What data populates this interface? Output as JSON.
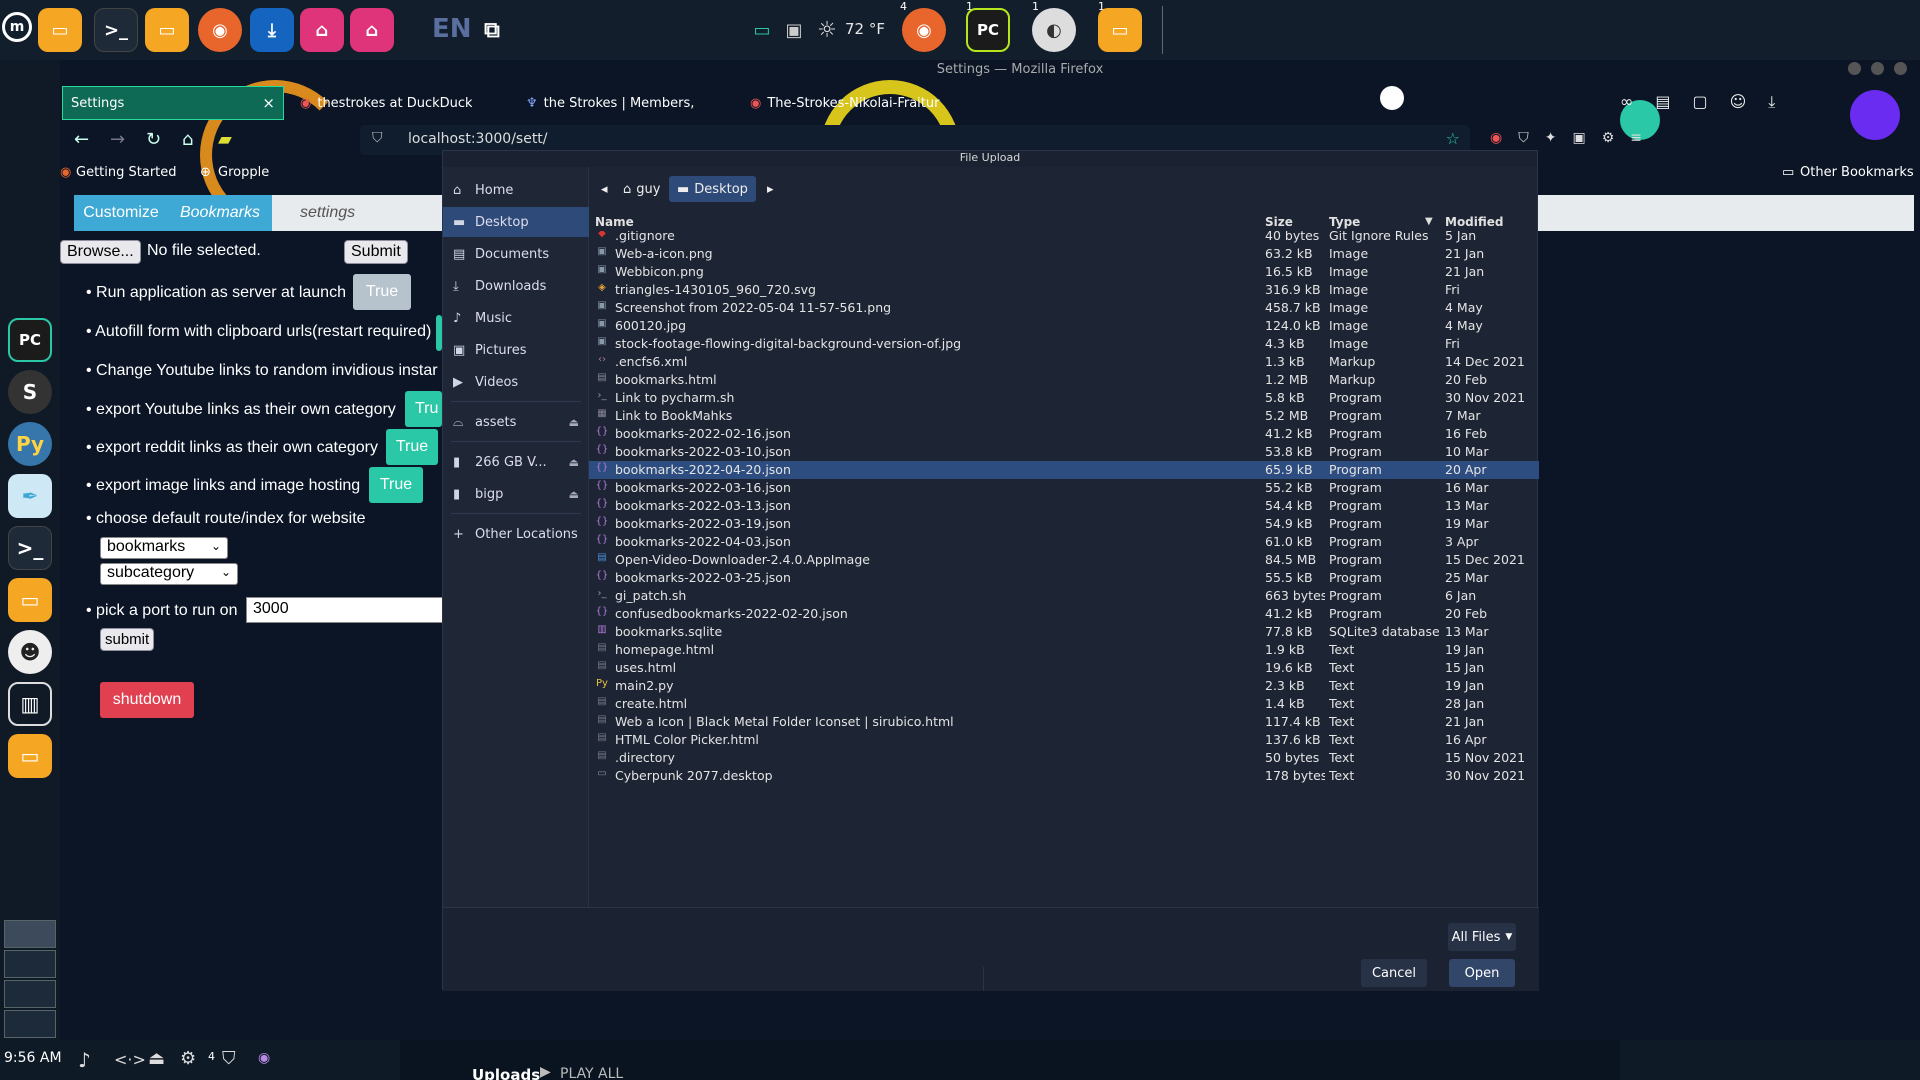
{
  "window_title": "Settings — Mozilla Firefox",
  "topbar": {
    "language": "EN",
    "weather": "72 °F",
    "badges": [
      "4",
      "1",
      "1",
      "1"
    ]
  },
  "tabs": [
    {
      "label": "Settings",
      "close": "×"
    },
    {
      "label": "thestrokes at DuckDuckGo",
      "close": "×"
    },
    {
      "label": "the Strokes | Members, Alb",
      "close": "×"
    },
    {
      "label": "The-Strokes-Nikolai-Fraitur",
      "close": "×"
    }
  ],
  "navbar": {
    "url": "localhost:3000/sett/"
  },
  "bookmarks_bar": {
    "items": [
      "Getting Started",
      "Gropple"
    ],
    "other": "Other Bookmarks"
  },
  "page": {
    "crumbs": [
      "Customize",
      "Bookmarks",
      "settings"
    ],
    "browse_button": "Browse...",
    "no_file": "No file selected.",
    "submit_top": "Submit",
    "settings": [
      {
        "label": "Run application as server at launch",
        "value": "True"
      },
      {
        "label": "Autofill form with clipboard urls(restart required)",
        "value": ""
      },
      {
        "label": "Change Youtube links to random invidious instar",
        "value": ""
      },
      {
        "label": "export Youtube links as their own category",
        "value": "Tru"
      },
      {
        "label": "export reddit links as their own category",
        "value": "True"
      },
      {
        "label": "export image links and image hosting",
        "value": "True"
      },
      {
        "label": "choose default route/index for website",
        "value": ""
      },
      {
        "label": "pick a port to run on",
        "value": ""
      }
    ],
    "route_select": "bookmarks",
    "subroute_select": "subcategory",
    "port_value": "3000",
    "submit_bottom": "submit",
    "shutdown": "shutdown"
  },
  "dialog": {
    "title": "File Upload",
    "places": [
      {
        "label": "Home",
        "icon": "home-icon"
      },
      {
        "label": "Desktop",
        "icon": "desktop-icon",
        "active": true
      },
      {
        "label": "Documents",
        "icon": "document-icon"
      },
      {
        "label": "Downloads",
        "icon": "download-icon"
      },
      {
        "label": "Music",
        "icon": "music-icon"
      },
      {
        "label": "Pictures",
        "icon": "picture-icon"
      },
      {
        "label": "Videos",
        "icon": "video-icon"
      },
      {
        "label": "assets",
        "icon": "drive-icon",
        "eject": true
      },
      {
        "label": "266 GB V...",
        "icon": "drive-icon",
        "eject": true
      },
      {
        "label": "bigp",
        "icon": "drive-icon",
        "eject": true
      },
      {
        "label": "Other Locations",
        "icon": "plus-icon"
      }
    ],
    "path": [
      "guy",
      "Desktop"
    ],
    "columns": {
      "name": "Name",
      "size": "Size",
      "type": "Type",
      "modified": "Modified"
    },
    "files": [
      {
        "name": ".gitignore",
        "size": "40 bytes",
        "type": "Git Ignore Rules",
        "modified": "5 Jan",
        "icon": "ruby-icon"
      },
      {
        "name": "Web-a-icon.png",
        "size": "63.2 kB",
        "type": "Image",
        "modified": "21 Jan",
        "icon": "image-icon"
      },
      {
        "name": "Webbicon.png",
        "size": "16.5 kB",
        "type": "Image",
        "modified": "21 Jan",
        "icon": "image-icon"
      },
      {
        "name": "triangles-1430105_960_720.svg",
        "size": "316.9 kB",
        "type": "Image",
        "modified": "Fri",
        "icon": "svg-icon"
      },
      {
        "name": "Screenshot from 2022-05-04 11-57-561.png",
        "size": "458.7 kB",
        "type": "Image",
        "modified": "4 May",
        "icon": "image-icon"
      },
      {
        "name": "600120.jpg",
        "size": "124.0 kB",
        "type": "Image",
        "modified": "4 May",
        "icon": "image-icon"
      },
      {
        "name": "stock-footage-flowing-digital-background-version-of.jpg",
        "size": "4.3 kB",
        "type": "Image",
        "modified": "Fri",
        "icon": "image-icon"
      },
      {
        "name": ".encfs6.xml",
        "size": "1.3 kB",
        "type": "Markup",
        "modified": "14 Dec 2021",
        "icon": "code-icon"
      },
      {
        "name": "bookmarks.html",
        "size": "1.2 MB",
        "type": "Markup",
        "modified": "20 Feb",
        "icon": "html-icon"
      },
      {
        "name": "Link to pycharm.sh",
        "size": "5.8 kB",
        "type": "Program",
        "modified": "30 Nov 2021",
        "icon": "terminal-icon"
      },
      {
        "name": "Link to BookMahks",
        "size": "5.2 MB",
        "type": "Program",
        "modified": "7 Mar",
        "icon": "executable-icon"
      },
      {
        "name": "bookmarks-2022-02-16.json",
        "size": "41.2 kB",
        "type": "Program",
        "modified": "16 Feb",
        "icon": "json-icon"
      },
      {
        "name": "bookmarks-2022-03-10.json",
        "size": "53.8 kB",
        "type": "Program",
        "modified": "10 Mar",
        "icon": "json-icon"
      },
      {
        "name": "bookmarks-2022-04-20.json",
        "size": "65.9 kB",
        "type": "Program",
        "modified": "20 Apr",
        "icon": "json-icon",
        "selected": true
      },
      {
        "name": "bookmarks-2022-03-16.json",
        "size": "55.2 kB",
        "type": "Program",
        "modified": "16 Mar",
        "icon": "json-icon"
      },
      {
        "name": "bookmarks-2022-03-13.json",
        "size": "54.4 kB",
        "type": "Program",
        "modified": "13 Mar",
        "icon": "json-icon"
      },
      {
        "name": "bookmarks-2022-03-19.json",
        "size": "54.9 kB",
        "type": "Program",
        "modified": "19 Mar",
        "icon": "json-icon"
      },
      {
        "name": "bookmarks-2022-04-03.json",
        "size": "61.0 kB",
        "type": "Program",
        "modified": "3 Apr",
        "icon": "json-icon"
      },
      {
        "name": "Open-Video-Downloader-2.4.0.AppImage",
        "size": "84.5 MB",
        "type": "Program",
        "modified": "15 Dec 2021",
        "icon": "appimage-icon"
      },
      {
        "name": "bookmarks-2022-03-25.json",
        "size": "55.5 kB",
        "type": "Program",
        "modified": "25 Mar",
        "icon": "json-icon"
      },
      {
        "name": "gi_patch.sh",
        "size": "663 bytes",
        "type": "Program",
        "modified": "6 Jan",
        "icon": "terminal-icon"
      },
      {
        "name": "confusedbookmarks-2022-02-20.json",
        "size": "41.2 kB",
        "type": "Program",
        "modified": "20 Feb",
        "icon": "json-icon"
      },
      {
        "name": "bookmarks.sqlite",
        "size": "77.8 kB",
        "type": "SQLite3 database",
        "modified": "13 Mar",
        "icon": "database-icon"
      },
      {
        "name": "homepage.html",
        "size": "1.9 kB",
        "type": "Text",
        "modified": "19 Jan",
        "icon": "text-icon"
      },
      {
        "name": "uses.html",
        "size": "19.6 kB",
        "type": "Text",
        "modified": "15 Jan",
        "icon": "text-icon"
      },
      {
        "name": "main2.py",
        "size": "2.3 kB",
        "type": "Text",
        "modified": "19 Jan",
        "icon": "python-icon"
      },
      {
        "name": "create.html",
        "size": "1.4 kB",
        "type": "Text",
        "modified": "28 Jan",
        "icon": "text-icon"
      },
      {
        "name": "Web a Icon | Black Metal Folder Iconset | sirubico.html",
        "size": "117.4 kB",
        "type": "Text",
        "modified": "21 Jan",
        "icon": "text-icon"
      },
      {
        "name": "HTML Color Picker.html",
        "size": "137.6 kB",
        "type": "Text",
        "modified": "16 Apr",
        "icon": "text-icon"
      },
      {
        "name": ".directory",
        "size": "50 bytes",
        "type": "Text",
        "modified": "15 Nov 2021",
        "icon": "text-icon"
      },
      {
        "name": "Cyberpunk 2077.desktop",
        "size": "178 bytes",
        "type": "Text",
        "modified": "30 Nov 2021",
        "icon": "desktop-file-icon"
      }
    ],
    "filter": "All Files",
    "cancel": "Cancel",
    "open": "Open"
  },
  "bottombar": {
    "clock": "9:56 AM",
    "tray_count": "4",
    "uploads": "Uploads",
    "play_all": "PLAY ALL"
  },
  "colors": {
    "accent_green": "#2ac8a6",
    "selection_blue": "#2d4d80",
    "shutdown_red": "#e04050",
    "crumb_blue": "#3fa9d5"
  }
}
